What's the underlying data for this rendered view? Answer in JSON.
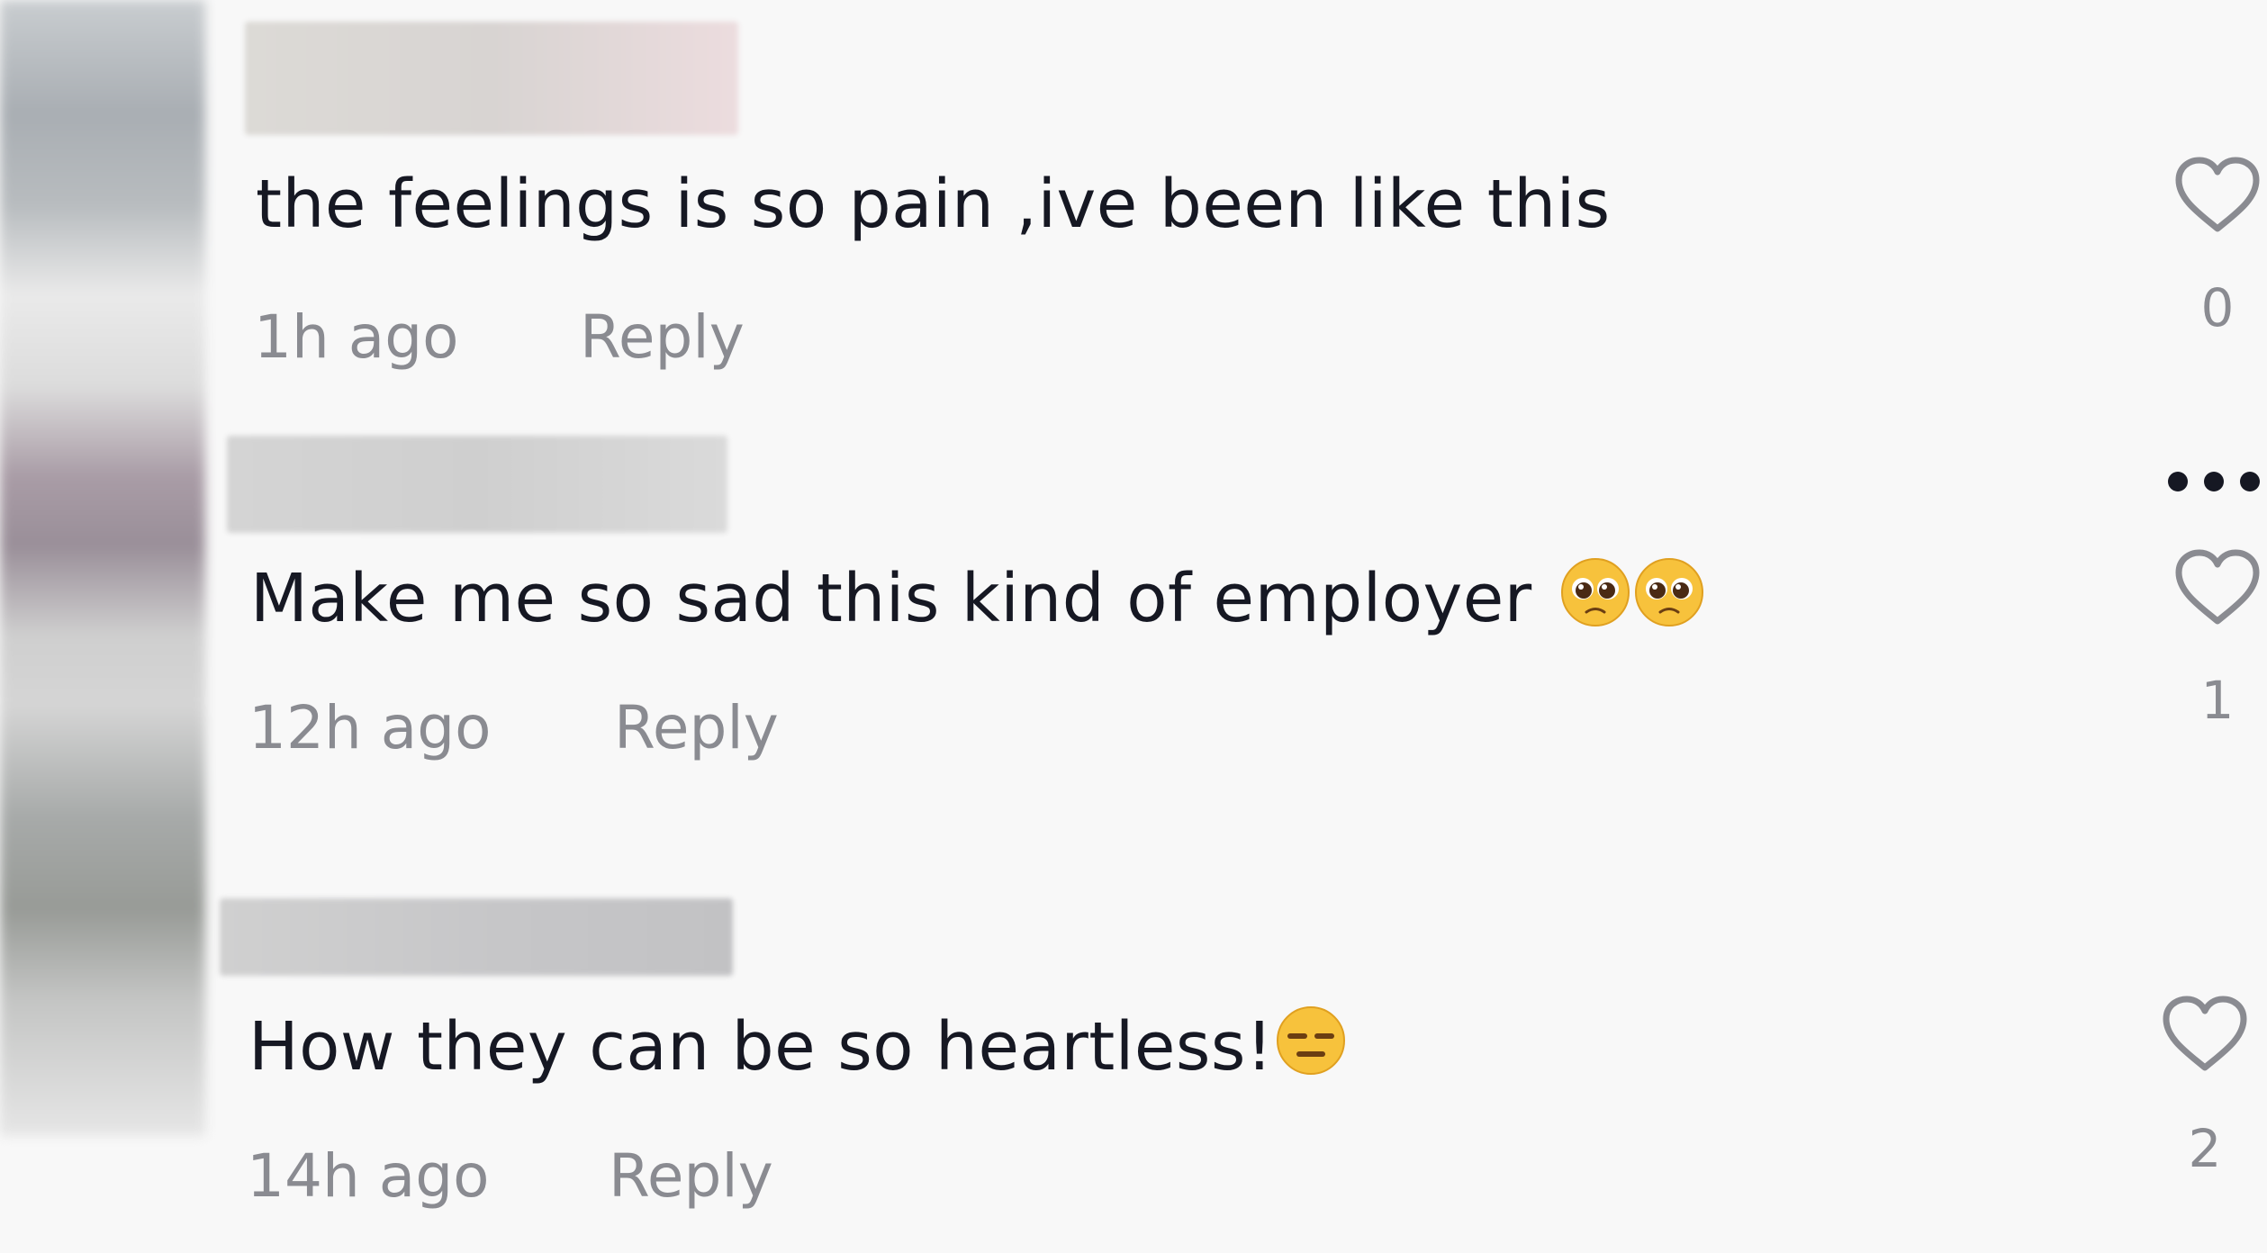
{
  "comments": [
    {
      "text": "the feelings is so pain ,ive been like this",
      "time": "1h ago",
      "reply_label": "Reply",
      "likes": "0"
    },
    {
      "text": "Make me so sad this kind of employer",
      "emoji_icons": [
        "pleading-face-emoji",
        "pleading-face-emoji"
      ],
      "time": "12h ago",
      "reply_label": "Reply",
      "likes": "1"
    },
    {
      "text": "How they can be so heartless!",
      "emoji_icons": [
        "expressionless-face-emoji"
      ],
      "time": "14h ago",
      "reply_label": "Reply",
      "likes": "2"
    }
  ],
  "icons": {
    "like": "heart-outline-icon",
    "more": "more-horizontal-icon"
  },
  "colors": {
    "text_primary": "#161823",
    "text_secondary": "#8a8b91",
    "background": "#f8f8f8"
  }
}
